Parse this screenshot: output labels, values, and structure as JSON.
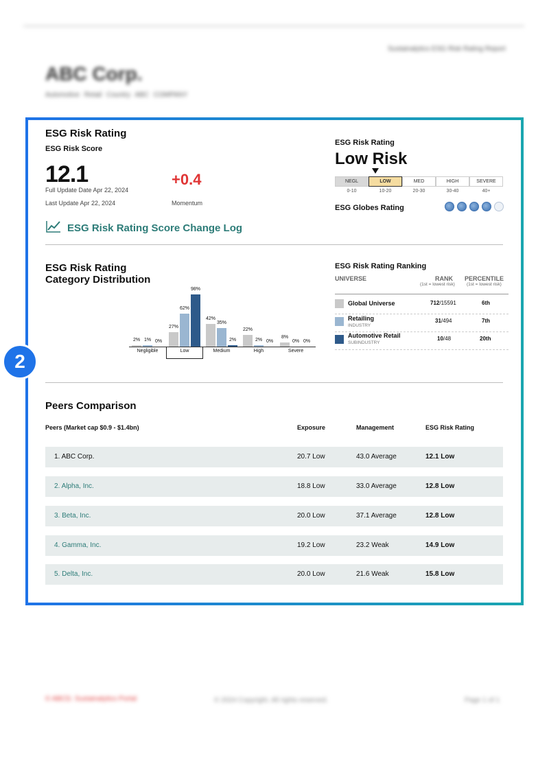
{
  "background": {
    "report_title": "Sustainalytics ESG Risk Rating Report",
    "company": "ABC Corp.",
    "meta": "Automotive Retail  Country  ABC COMPANY",
    "footer_left": "© ABCD. Sustainalytics Portal",
    "footer_mid": "© 2024 Copyright. All rights reserved.",
    "footer_right": "Page 1 of 1"
  },
  "badge": "2",
  "risk_rating": {
    "title": "ESG Risk Rating",
    "score_label": "ESG Risk Score",
    "score": "12.1",
    "full_update": "Full Update Date Apr 22, 2024",
    "last_update": "Last Update Apr 22, 2024",
    "momentum_value": "+0.4",
    "momentum_label": "Momentum",
    "change_log": "ESG Risk Rating Score Change Log"
  },
  "rating_panel": {
    "title": "ESG Risk Rating",
    "level": "Low Risk",
    "scale": [
      {
        "label": "NEGL",
        "range": "0-10"
      },
      {
        "label": "LOW",
        "range": "10-20"
      },
      {
        "label": "MED",
        "range": "20-30"
      },
      {
        "label": "HIGH",
        "range": "30-40"
      },
      {
        "label": "SEVERE",
        "range": "40+"
      }
    ],
    "globes_label": "ESG Globes Rating",
    "globes_filled": 4,
    "globes_total": 5
  },
  "distribution": {
    "title_line1": "ESG Risk Rating",
    "title_line2": "Category Distribution"
  },
  "chart_data": {
    "type": "bar",
    "categories": [
      "Negligible",
      "Low",
      "Medium",
      "High",
      "Severe"
    ],
    "highlighted_category": "Low",
    "series": [
      {
        "name": "Global Universe",
        "color": "#c9c9c9",
        "values": [
          2,
          27,
          42,
          22,
          8
        ]
      },
      {
        "name": "Retailing",
        "color": "#9ab6d1",
        "values": [
          1,
          62,
          35,
          2,
          0
        ]
      },
      {
        "name": "Automotive Retail",
        "color": "#2e5a8a",
        "values": [
          0,
          98,
          2,
          0,
          0
        ]
      }
    ],
    "value_labels": [
      [
        "2%",
        "1%",
        "0%"
      ],
      [
        "27%",
        "62%",
        "98%"
      ],
      [
        "42%",
        "35%",
        "2%"
      ],
      [
        "22%",
        "2%",
        "0%"
      ],
      [
        "8%",
        "0%",
        "0%"
      ]
    ]
  },
  "ranking": {
    "title": "ESG Risk Rating Ranking",
    "col_universe": "UNIVERSE",
    "col_rank": "RANK",
    "col_rank_note": "(1st = lowest risk)",
    "col_percentile": "PERCENTILE",
    "col_percentile_note": "(1st = lowest risk)",
    "rows": [
      {
        "name": "Global Universe",
        "sub": "",
        "rank": "712",
        "total": "/15591",
        "percentile": "6th",
        "color": "#c9c9c9"
      },
      {
        "name": "Retailing",
        "sub": "INDUSTRY",
        "rank": "31",
        "total": "/494",
        "percentile": "7th",
        "color": "#9ab6d1"
      },
      {
        "name": "Automotive Retail",
        "sub": "SUBINDUSTRY",
        "rank": "10",
        "total": "/48",
        "percentile": "20th",
        "color": "#2e5a8a"
      }
    ]
  },
  "peers": {
    "title": "Peers Comparison",
    "col_peers": "Peers (Market cap $0.9 - $1.4bn)",
    "col_exposure": "Exposure",
    "col_management": "Management",
    "col_rating": "ESG Risk Rating",
    "rows": [
      {
        "name": "1. ABC Corp.",
        "exposure": "20.7 Low",
        "management": "43.0 Average",
        "rating": "12.1 Low"
      },
      {
        "name": "2. Alpha, Inc.",
        "exposure": "18.8 Low",
        "management": "33.0 Average",
        "rating": "12.8 Low"
      },
      {
        "name": "3. Beta, Inc.",
        "exposure": "20.0 Low",
        "management": "37.1 Average",
        "rating": "12.8 Low"
      },
      {
        "name": "4. Gamma, Inc.",
        "exposure": "19.2 Low",
        "management": "23.2 Weak",
        "rating": "14.9 Low"
      },
      {
        "name": "5. Delta, Inc.",
        "exposure": "20.0 Low",
        "management": "21.6 Weak",
        "rating": "15.8 Low"
      }
    ]
  }
}
